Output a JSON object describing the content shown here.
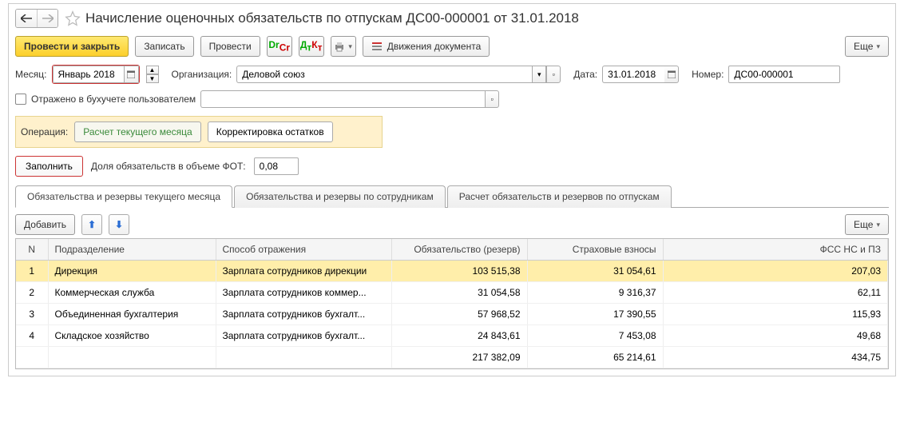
{
  "title": "Начисление оценочных обязательств по отпускам ДС00-000001 от 31.01.2018",
  "toolbar": {
    "post_close": "Провести и закрыть",
    "save": "Записать",
    "post": "Провести",
    "movements": "Движения документа",
    "more": "Еще"
  },
  "fields": {
    "month_label": "Месяц:",
    "month_value": "Январь 2018",
    "org_label": "Организация:",
    "org_value": "Деловой союз",
    "date_label": "Дата:",
    "date_value": "31.01.2018",
    "number_label": "Номер:",
    "number_value": "ДС00-000001",
    "reflected_label": "Отражено в бухучете пользователем",
    "reflected_value": ""
  },
  "operation": {
    "label": "Операция:",
    "calc_current": "Расчет текущего месяца",
    "correction": "Корректировка остатков"
  },
  "fill": {
    "button": "Заполнить",
    "fot_label": "Доля обязательств в объеме ФОТ:",
    "fot_value": "0,08"
  },
  "tabs": {
    "t1": "Обязательства и резервы текущего месяца",
    "t2": "Обязательства и резервы по сотрудникам",
    "t3": "Расчет обязательств и резервов по отпускам"
  },
  "table_toolbar": {
    "add": "Добавить",
    "more": "Еще"
  },
  "columns": {
    "n": "N",
    "dept": "Подразделение",
    "method": "Способ отражения",
    "reserve": "Обязательство (резерв)",
    "insurance": "Страховые взносы",
    "fss": "ФСС НС и ПЗ"
  },
  "rows": [
    {
      "n": "1",
      "dept": "Дирекция",
      "method": "Зарплата сотрудников дирекции",
      "reserve": "103 515,38",
      "insurance": "31 054,61",
      "fss": "207,03"
    },
    {
      "n": "2",
      "dept": "Коммерческая служба",
      "method": "Зарплата сотрудников коммер...",
      "reserve": "31 054,58",
      "insurance": "9 316,37",
      "fss": "62,11"
    },
    {
      "n": "3",
      "dept": "Объединенная бухгалтерия",
      "method": "Зарплата сотрудников бухгалт...",
      "reserve": "57 968,52",
      "insurance": "17 390,55",
      "fss": "115,93"
    },
    {
      "n": "4",
      "dept": "Складское хозяйство",
      "method": "Зарплата сотрудников бухгалт...",
      "reserve": "24 843,61",
      "insurance": "7 453,08",
      "fss": "49,68"
    }
  ],
  "totals": {
    "reserve": "217 382,09",
    "insurance": "65 214,61",
    "fss": "434,75"
  }
}
